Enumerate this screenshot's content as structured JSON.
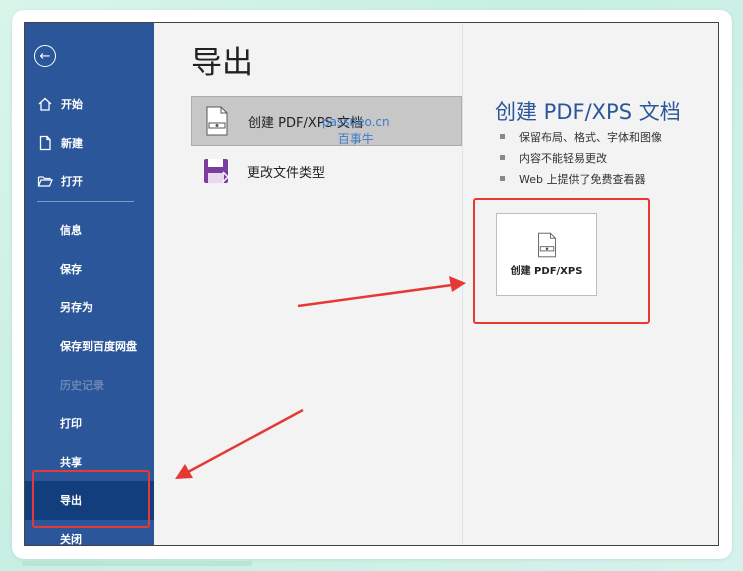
{
  "sidebar": {
    "back_icon": "back-arrow-icon",
    "top_items": [
      {
        "label": "开始",
        "icon": "home-icon"
      },
      {
        "label": "新建",
        "icon": "new-document-icon"
      },
      {
        "label": "打开",
        "icon": "open-folder-icon"
      }
    ],
    "items": [
      {
        "label": "信息"
      },
      {
        "label": "保存"
      },
      {
        "label": "另存为"
      },
      {
        "label": "保存到百度网盘"
      },
      {
        "label": "历史记录",
        "disabled": true
      },
      {
        "label": "打印"
      },
      {
        "label": "共享"
      },
      {
        "label": "导出",
        "active": true
      },
      {
        "label": "关闭"
      }
    ]
  },
  "main": {
    "title": "导出",
    "options": [
      {
        "label": "创建 PDF/XPS 文档",
        "icon": "pdf-document-icon",
        "selected": true
      },
      {
        "label": "更改文件类型",
        "icon": "change-file-type-icon",
        "selected": false
      }
    ]
  },
  "detail": {
    "title": "创建 PDF/XPS 文档",
    "bullets": [
      "保留布局、格式、字体和图像",
      "内容不能轻易更改",
      "Web 上提供了免费查看器"
    ],
    "button_label": "创建 PDF/XPS"
  },
  "watermark": {
    "line1": "passneo.cn",
    "line2": "百事牛"
  },
  "colors": {
    "sidebar": "#2b579a",
    "active": "#123e7d",
    "accent": "#2b579a",
    "annotation": "#e53935"
  }
}
